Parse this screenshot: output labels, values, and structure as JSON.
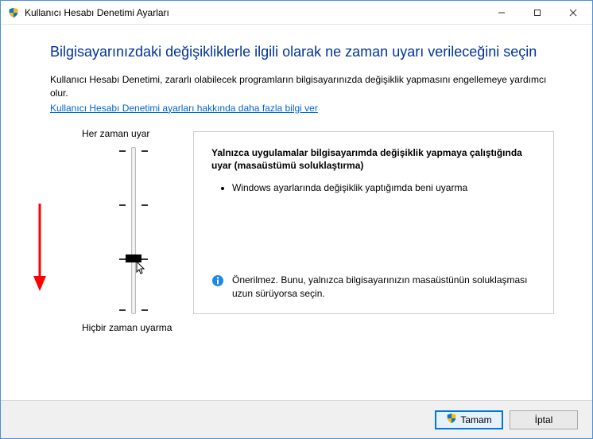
{
  "window": {
    "title": "Kullanıcı Hesabı Denetimi Ayarları"
  },
  "heading": "Bilgisayarınızdaki değişikliklerle ilgili olarak ne zaman uyarı verileceğini seçin",
  "description": "Kullanıcı Hesabı Denetimi, zararlı olabilecek programların bilgisayarınızda değişiklik yapmasını engellemeye yardımcı olur.",
  "help_link": "Kullanıcı Hesabı Denetimi ayarları hakkında daha fazla bilgi ver",
  "slider": {
    "top_label": "Her zaman uyar",
    "bottom_label": "Hiçbir zaman uyarma"
  },
  "info": {
    "title": "Yalnızca uygulamalar bilgisayarımda değişiklik yapmaya çalıştığında uyar (masaüstümü soluklaştırma)",
    "bullet1": "Windows ayarlarında değişiklik yaptığımda beni uyarma",
    "recommend": "Önerilmez. Bunu, yalnızca bilgisayarınızın masaüstünün soluklaşması uzun sürüyorsa seçin."
  },
  "buttons": {
    "ok": "Tamam",
    "cancel": "İptal"
  }
}
